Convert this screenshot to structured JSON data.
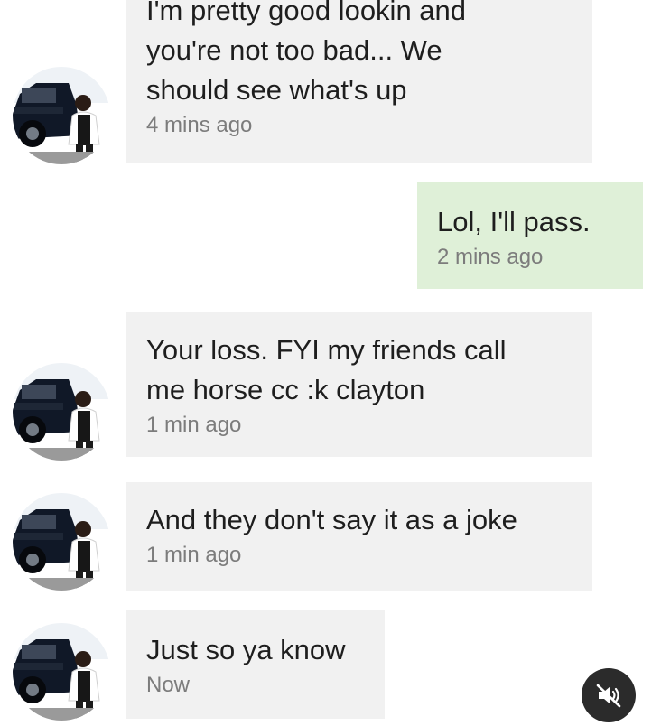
{
  "messages": [
    {
      "direction": "incoming",
      "text": "I'm pretty good lookin and\nyou're not too bad... We\nshould see what's up",
      "time": "4 mins ago"
    },
    {
      "direction": "outgoing",
      "text": "Lol, I'll pass.",
      "time": "2 mins ago"
    },
    {
      "direction": "incoming",
      "text": "Your loss. FYI my friends call\nme horse cc :k clayton",
      "time": "1 min ago"
    },
    {
      "direction": "incoming",
      "text": "And they don't say it as a joke",
      "time": "1 min ago"
    },
    {
      "direction": "incoming",
      "text": "Just so ya know",
      "time": "Now"
    }
  ],
  "colors": {
    "incoming_bubble": "#f1f1f1",
    "outgoing_bubble": "#dff0d8",
    "message_text": "#1e1e1e",
    "timestamp_text": "#7c7c7c",
    "mute_button_bg": "#2b2b2b"
  },
  "icons": {
    "avatar": "avatar-photo-truck",
    "mute": "speaker-muted-icon"
  }
}
